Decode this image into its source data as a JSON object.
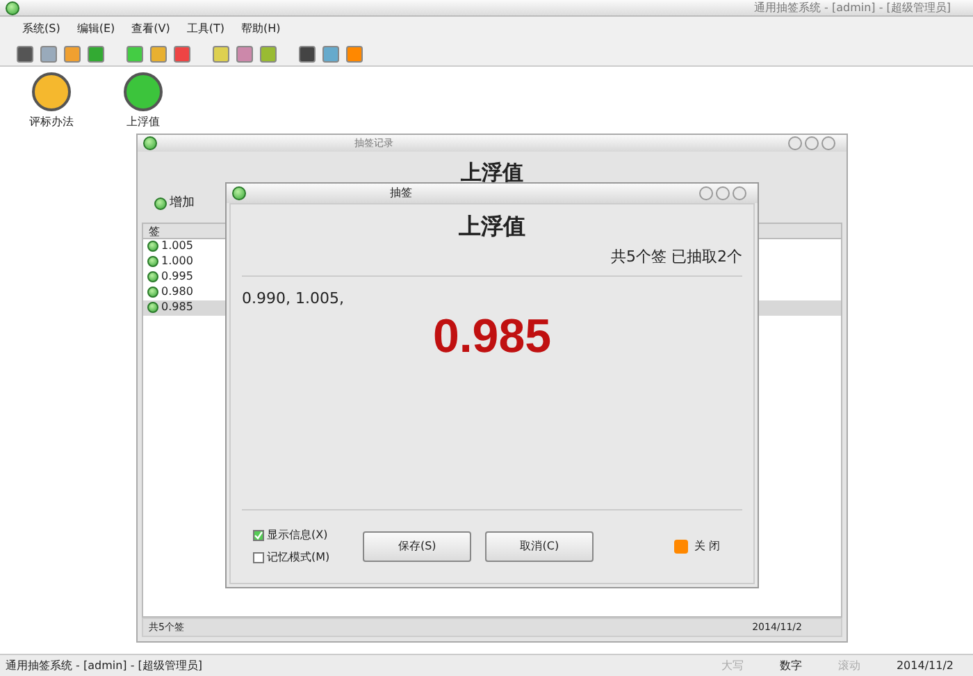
{
  "window": {
    "title": "通用抽签系统 - [admin] - [超级管理员]"
  },
  "menu": [
    "系统(S)",
    "编辑(E)",
    "查看(V)",
    "工具(T)",
    "帮助(H)"
  ],
  "desktop_icons": [
    {
      "label": "评标办法",
      "color": "#f5b82e"
    },
    {
      "label": "上浮值",
      "color": "#3cc43c"
    }
  ],
  "records_window": {
    "title": "抽签记录",
    "heading": "上浮值",
    "add_button": "增加",
    "column": "签",
    "rows": [
      {
        "value": "1.005",
        "selected": false
      },
      {
        "value": "1.000",
        "selected": false
      },
      {
        "value": "0.995",
        "selected": false
      },
      {
        "value": "0.980",
        "selected": false
      },
      {
        "value": "0.985",
        "selected": true
      }
    ],
    "status": [
      "共5个签",
      "2014/11/2"
    ]
  },
  "draw_dialog": {
    "title": "抽签",
    "heading": "上浮值",
    "summary": "共5个签 已抽取2个",
    "history": "0.990, 1.005,",
    "result": "0.985",
    "options": [
      {
        "label": "显示信息(X)",
        "checked": true
      },
      {
        "label": "记忆模式(M)",
        "checked": false
      }
    ],
    "buttons": [
      "保存(S)",
      "取消(C)"
    ],
    "close": "关 闭"
  },
  "status_bar": [
    {
      "text": "通用抽签系统 - [admin] - [超级管理员]",
      "disabled": false
    },
    {
      "text": "大写",
      "disabled": true
    },
    {
      "text": "数字",
      "disabled": false
    },
    {
      "text": "滚动",
      "disabled": true
    },
    {
      "text": "2014/11/2",
      "disabled": false
    }
  ]
}
